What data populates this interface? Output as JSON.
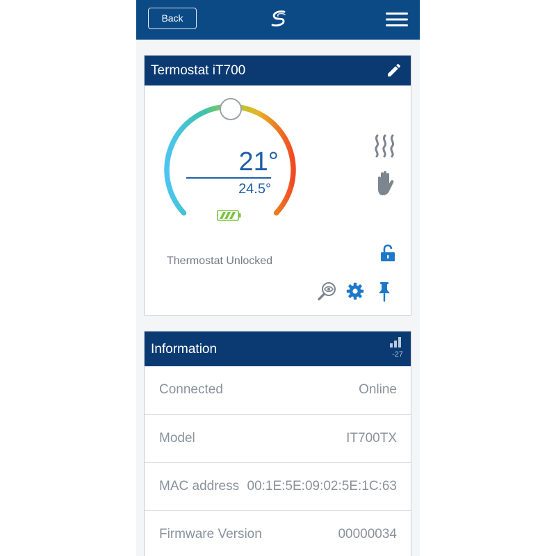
{
  "topbar": {
    "back_label": "Back",
    "logo_icon": "salus-swirl-logo",
    "menu_icon": "hamburger-menu-icon"
  },
  "thermostat": {
    "title": "Termostat iT700",
    "setpoint": "21°",
    "current_temperature": "24.5°",
    "lock_status": "Thermostat Unlocked",
    "icons": {
      "edit": "pencil-icon",
      "heating": "heat-waves-icon",
      "manual": "hand-icon",
      "lock": "unlocked-padlock-icon",
      "identify": "search-eye-icon",
      "settings": "gear-icon",
      "pin": "pushpin-icon",
      "battery": "battery-icon"
    },
    "battery_level": 0.75
  },
  "information": {
    "title": "Information",
    "signal_strength": "-27",
    "rows": [
      {
        "label": "Connected",
        "value": "Online"
      },
      {
        "label": "Model",
        "value": "IT700TX"
      },
      {
        "label": "MAC address",
        "value": "00:1E:5E:09:02:5E:1C:63"
      },
      {
        "label": "Firmware Version",
        "value": "00000034"
      }
    ]
  },
  "colors": {
    "topbar": "#0c4a86",
    "card_header": "#0b3a72",
    "accent_blue": "#1d78c9",
    "temperature_text": "#1d5ea8",
    "icon_grey": "#7d858e",
    "label_grey": "#8a929c"
  }
}
